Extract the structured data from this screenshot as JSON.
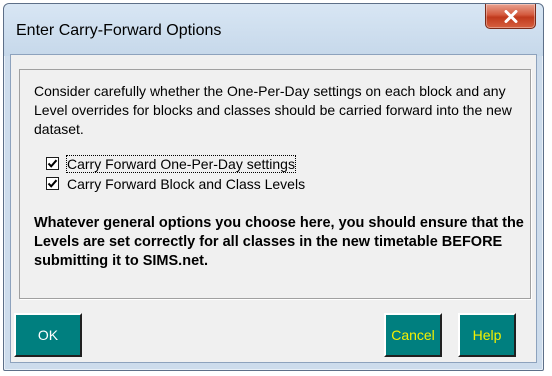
{
  "window": {
    "title": "Enter Carry-Forward Options",
    "close_glyph": "X"
  },
  "intro_text": "Consider carefully whether the One-Per-Day settings on each block and any Level overrides for blocks and classes should be carried forward into the new dataset.",
  "options": [
    {
      "label": "Carry Forward One-Per-Day settings",
      "checked": true
    },
    {
      "label": "Carry Forward Block and Class Levels",
      "checked": true
    }
  ],
  "warning_text": "Whatever general options you choose here, you should ensure that the Levels are set correctly for all classes in the new timetable BEFORE submitting it to SIMS.net.",
  "buttons": {
    "ok": "OK",
    "cancel": "Cancel",
    "help": "Help"
  },
  "colors": {
    "button_bg": "#007f7f",
    "ok_text": "#ffffff",
    "cancel_help_text": "#f4f000",
    "titlebar": "#cddcec",
    "close_button": "#c8452a"
  },
  "icons": {
    "close": "close-icon",
    "check": "checkmark-icon"
  }
}
